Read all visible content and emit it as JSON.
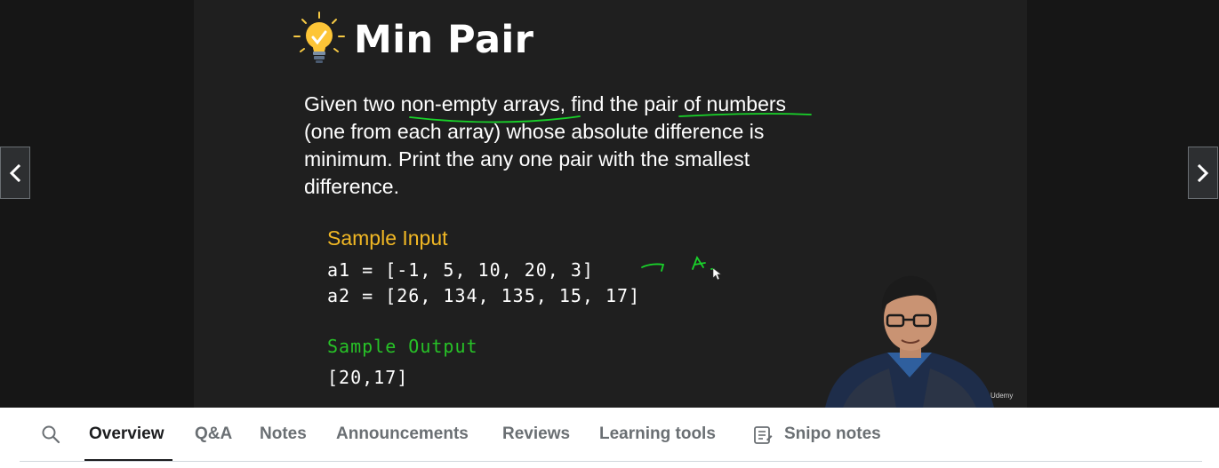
{
  "slide": {
    "title": "Min Pair",
    "description_lines": [
      "Given two non-empty arrays, find the pair of numbers",
      "(one from each array) whose absolute difference is",
      "minimum. Print the any one pair with the smallest",
      "difference."
    ],
    "sample_input_label": "Sample Input",
    "input_lines": [
      "a1 = [-1, 5, 10, 20, 3]",
      "a2 = [26, 134, 135, 15, 17]"
    ],
    "sample_output_label": "Sample Output",
    "output_line": "[20,17]",
    "annotation_text": "A",
    "watermark": "Udemy"
  },
  "nav": {
    "prev_icon": "chevron-left-icon",
    "next_icon": "chevron-right-icon"
  },
  "tabs": {
    "search_icon": "search-icon",
    "items": [
      {
        "label": "Overview"
      },
      {
        "label": "Q&A"
      },
      {
        "label": "Notes"
      },
      {
        "label": "Announcements"
      },
      {
        "label": "Reviews"
      },
      {
        "label": "Learning tools"
      },
      {
        "label": "Snipo notes"
      }
    ],
    "active": "Overview"
  },
  "colors": {
    "accent_yellow": "#f2b824",
    "output_green": "#27c227",
    "annotation_green": "#19d32a",
    "text_dark": "#1c1d1f",
    "text_muted": "#6a6f73"
  }
}
